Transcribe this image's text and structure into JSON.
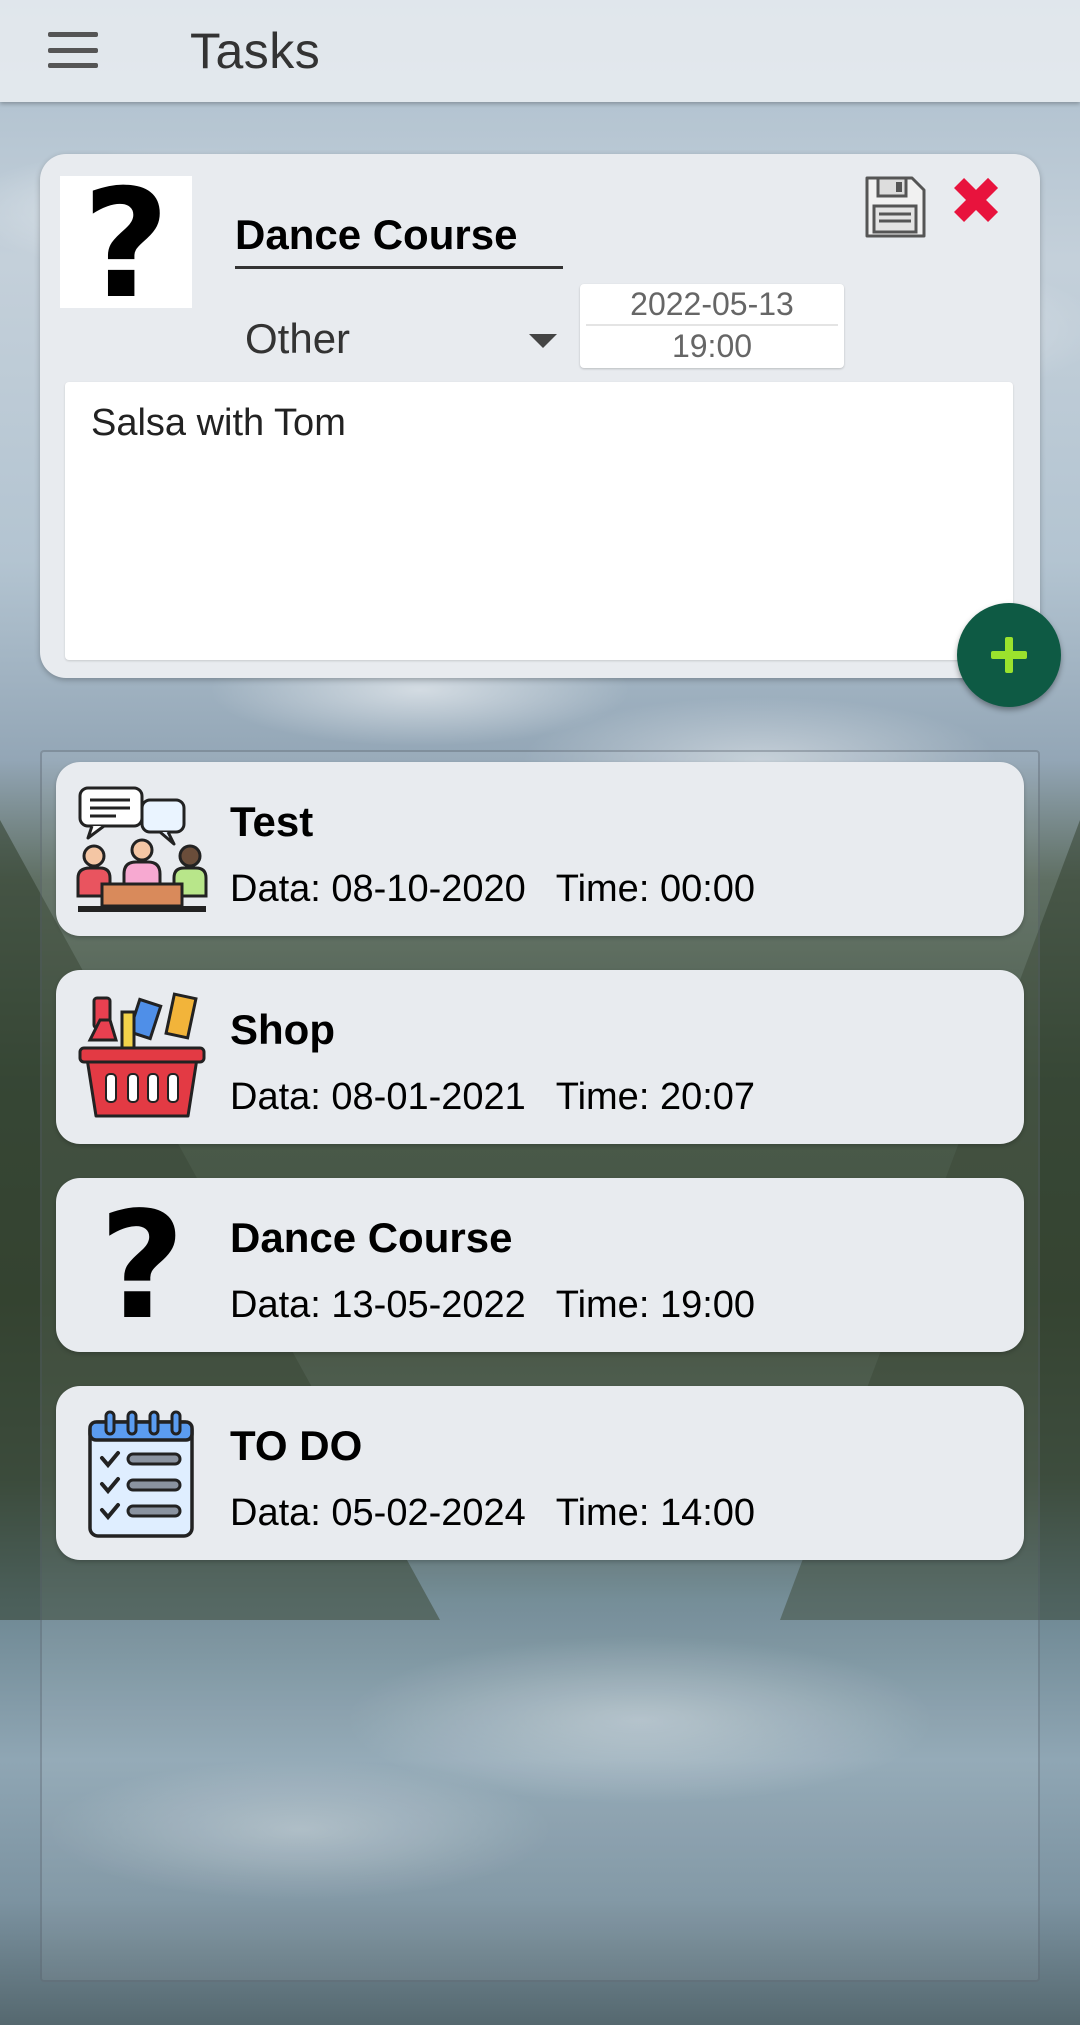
{
  "app_bar": {
    "title": "Tasks"
  },
  "editor": {
    "title_value": "Dance Course",
    "category": "Other",
    "date": "2022-05-13",
    "time": "19:00",
    "note": "Salsa with Tom",
    "save_icon": "floppy-disk-icon",
    "close_icon": "close-icon",
    "add_icon": "plus-icon",
    "colors": {
      "close": "#e8133d",
      "fab": "#0e5a44",
      "fab_plus": "#9be22d"
    }
  },
  "tasks": [
    {
      "title": "Test",
      "date_label": "Data:",
      "date": "08-10-2020",
      "time_label": "Time:",
      "time": "00:00",
      "icon": "meeting-icon"
    },
    {
      "title": "Shop",
      "date_label": "Data:",
      "date": "08-01-2021",
      "time_label": "Time:",
      "time": "20:07",
      "icon": "shopping-basket-icon"
    },
    {
      "title": "Dance Course",
      "date_label": "Data:",
      "date": "13-05-2022",
      "time_label": "Time:",
      "time": "19:00",
      "icon": "question-mark-icon"
    },
    {
      "title": "TO DO",
      "date_label": "Data:",
      "date": "05-02-2024",
      "time_label": "Time:",
      "time": "14:00",
      "icon": "checklist-icon"
    }
  ]
}
